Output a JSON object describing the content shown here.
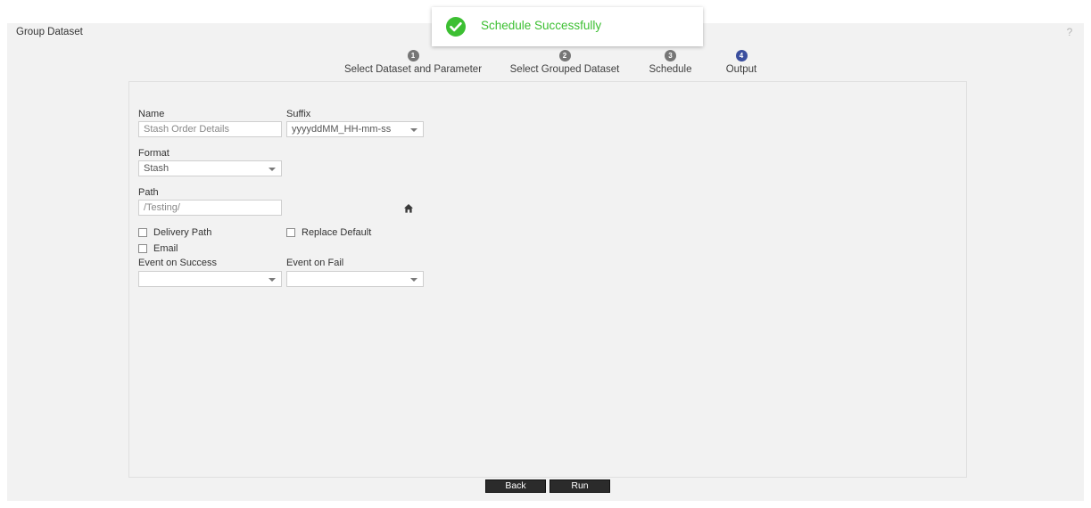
{
  "window": {
    "title": "Group Dataset",
    "help_icon": "question-mark-icon",
    "help_label": "?"
  },
  "toast": {
    "message": "Schedule Successfully",
    "icon": "check-circle-icon",
    "color": "#3cbf32"
  },
  "stepper": {
    "active_step": 4,
    "active_color": "#3b4f9e",
    "inactive_color": "#767676",
    "steps": [
      {
        "number": "1",
        "label": "Select Dataset and Parameter",
        "state": "inactive"
      },
      {
        "number": "2",
        "label": "Select Grouped Dataset",
        "state": "inactive"
      },
      {
        "number": "3",
        "label": "Schedule",
        "state": "inactive"
      },
      {
        "number": "4",
        "label": "Output",
        "state": "active"
      }
    ]
  },
  "form": {
    "name": {
      "label": "Name",
      "value": "Stash Order Details",
      "placeholder": "Stash Order Details"
    },
    "suffix": {
      "label": "Suffix",
      "value": "yyyyddMM_HH-mm-ss"
    },
    "format": {
      "label": "Format",
      "value": "Stash"
    },
    "path": {
      "label": "Path",
      "value": "/Testing/",
      "placeholder": "/Testing/",
      "home_icon": "home-icon"
    },
    "checkboxes": [
      {
        "label": "Delivery Path",
        "checked": false
      },
      {
        "label": "Replace Default",
        "checked": false
      },
      {
        "label": "Email",
        "checked": false
      }
    ],
    "event_on_success": {
      "label": "Event on Success",
      "value": ""
    },
    "event_on_fail": {
      "label": "Event on Fail",
      "value": ""
    }
  },
  "footer": {
    "back_label": "Back",
    "run_label": "Run"
  }
}
